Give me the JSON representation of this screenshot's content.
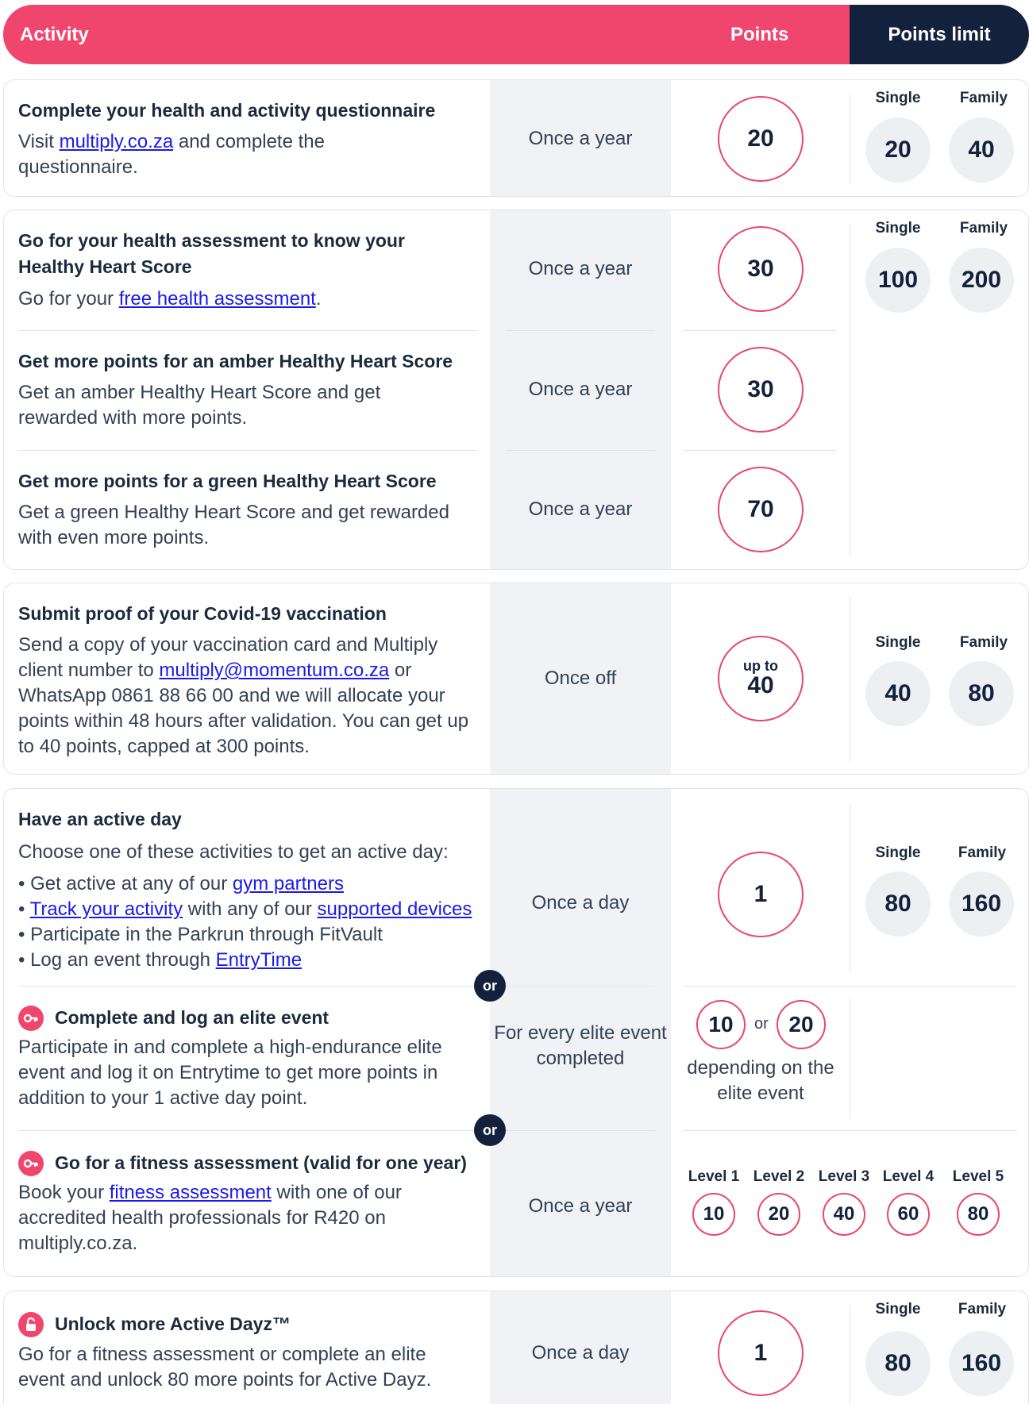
{
  "header": {
    "activity": "Activity",
    "points": "Points",
    "limit": "Points limit"
  },
  "labels": {
    "single": "Single",
    "family": "Family",
    "or": "or"
  },
  "rows": {
    "questionnaire": {
      "title": "Complete your health and activity questionnaire",
      "desc_pre": "Visit ",
      "desc_link": "multiply.co.za",
      "desc_post": " and complete the questionnaire.",
      "frequency": "Once a year",
      "points": "20",
      "limit_single": "20",
      "limit_family": "40"
    },
    "assessment": {
      "title": "Go for your health assessment to know your Healthy Heart Score",
      "desc_pre": "Go for your ",
      "desc_link": "free health assessment",
      "desc_post": ".",
      "frequency": "Once a year",
      "points": "30",
      "limit_single": "100",
      "limit_family": "200"
    },
    "amber": {
      "title": "Get more points for an amber Healthy Heart Score",
      "desc": "Get an amber Healthy Heart Score and get rewarded with more points.",
      "frequency": "Once a year",
      "points": "30"
    },
    "green": {
      "title": "Get more points for a green Healthy Heart Score",
      "desc": "Get a green Healthy Heart Score and get rewarded with even more points.",
      "frequency": "Once a year",
      "points": "70"
    },
    "covid": {
      "title": "Submit proof of your Covid-19 vaccination",
      "desc_pre": "Send a copy of your vaccination card and Multiply client number to ",
      "desc_link": "multiply@momentum.co.za",
      "desc_post": " or WhatsApp 0861 88 66 00 and we will allocate your points within 48 hours after validation. You can get up to 40 points, capped at 300 points.",
      "frequency": "Once off",
      "points_prefix": "up to",
      "points": "40",
      "limit_single": "40",
      "limit_family": "80"
    },
    "active_day": {
      "title": "Have an active day",
      "intro": "Choose one of these activities to get an active day:",
      "b1_pre": "Get active at any of our ",
      "b1_link": "gym partners",
      "b2_link": "Track your activity",
      "b2_mid": " with any of our ",
      "b2_link2": "supported devices",
      "b3": "Participate in the Parkrun through FitVault",
      "b4_pre": "Log an event through ",
      "b4_link": "EntryTime",
      "frequency": "Once a day",
      "points": "1",
      "limit_single": "80",
      "limit_family": "160"
    },
    "elite": {
      "title": "Complete and log an elite event",
      "desc": "Participate in and complete a high-endurance elite event and log it on Entrytime to get more points in addition to your 1 active day point.",
      "frequency": "For every elite event completed",
      "points_a": "10",
      "points_b": "20",
      "depending": "depending on the elite event"
    },
    "fitness": {
      "title": "Go for a fitness assessment (valid for one year)",
      "desc_pre": "Book your ",
      "desc_link": "fitness assessment",
      "desc_post": " with one of our accredited health professionals for R420 on multiply.co.za.",
      "frequency": "Once a year",
      "levels": [
        {
          "label": "Level 1",
          "value": "10"
        },
        {
          "label": "Level 2",
          "value": "20"
        },
        {
          "label": "Level 3",
          "value": "40"
        },
        {
          "label": "Level 4",
          "value": "60"
        },
        {
          "label": "Level 5",
          "value": "80"
        }
      ]
    },
    "unlock": {
      "title": "Unlock more Active Dayz™",
      "desc": "Go for a fitness assessment or complete an elite event and unlock 80 more points for Active Dayz.",
      "frequency": "Once a day",
      "points": "1",
      "limit_single": "80",
      "limit_family": "160"
    }
  },
  "icons": {
    "elite": "key-icon",
    "fitness": "key-icon",
    "unlock": "padlock-icon"
  },
  "colors": {
    "brand_pink": "#f0466e",
    "navy": "#14213d",
    "link": "#1a1aee"
  }
}
